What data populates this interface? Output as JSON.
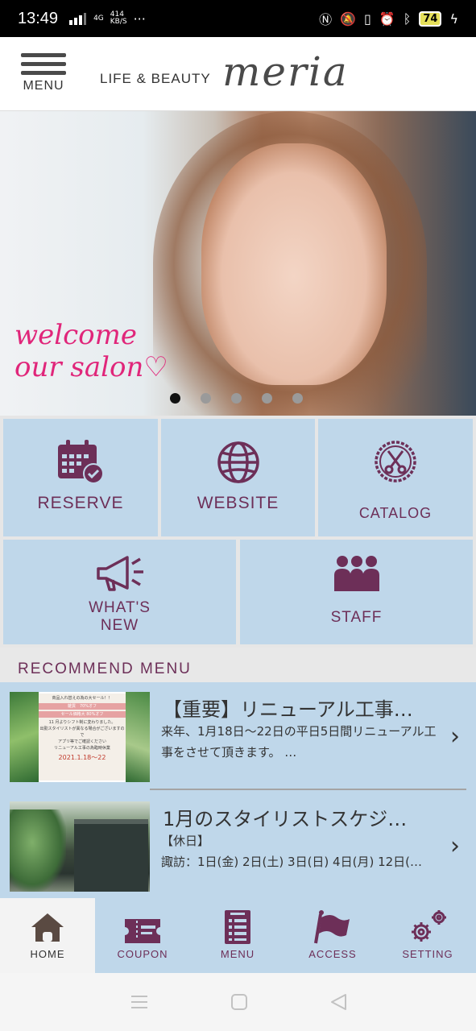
{
  "status_bar": {
    "time": "13:49",
    "network": "4G",
    "speed": "414\nKB/S",
    "more": "···",
    "battery": "74"
  },
  "header": {
    "menu_label": "MENU",
    "brand_prefix": "LIFE & BEAUTY",
    "brand_name": "meria"
  },
  "hero": {
    "welcome_line1": "welcome",
    "welcome_line2": "our salon♡",
    "slide_count": 5,
    "active_slide": 1
  },
  "tiles": {
    "reserve": "RESERVE",
    "website": "WEBSITE",
    "catalog": "CATALOG",
    "whats_new_1": "WHAT'S",
    "whats_new_2": "NEW",
    "staff": "STAFF"
  },
  "recommend": {
    "title": "RECOMMEND MENU",
    "items": [
      {
        "title": "【重要】リニューアル工事…",
        "body": "来年、1月18日～22日の平日5日間リニューアル工事をさせて頂きます。 …"
      },
      {
        "title": "1月のスタイリストスケジ…",
        "body_line1": "【休日】",
        "body_line2": "諏訪：1日(金) 2日(土) 3日(日) 4日(月) 12日(…"
      }
    ],
    "thumb1_lines": [
      "商品入れ替えの為の大セール！！",
      "雑貨　70%オフ",
      "セール価格大 80%オフ",
      "11 月よりシフト制に変わりました。",
      "出勤スタイリストが異なる場合がございますので",
      "アプリ等でご確認ください",
      "リニューアル工事の為臨時休業",
      "2021.1.18～22"
    ]
  },
  "tabbar": {
    "home": "HOME",
    "coupon": "COUPON",
    "menu": "MENU",
    "access": "ACCESS",
    "setting": "SETTING"
  },
  "colors": {
    "accent": "#6d2f58",
    "tile_bg": "#bfd7ea",
    "welcome": "#e0267a"
  }
}
